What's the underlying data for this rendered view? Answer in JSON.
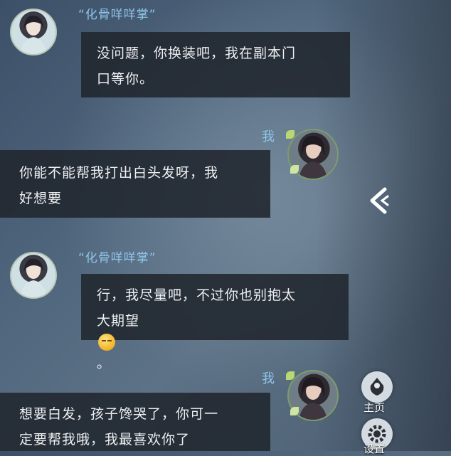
{
  "messages": [
    {
      "sender": "“化骨咩咩掌”",
      "lines": [
        "没问题，你换装吧，我在副本门",
        "口等你。"
      ]
    },
    {
      "sender": "我",
      "lines": [
        "你能不能帮我打出白头发呀，我",
        "好想要"
      ]
    },
    {
      "sender": "“化骨咩咩掌”",
      "lines": [
        "行，我尽量吧，不过你也别抱太",
        "大期望",
        "。"
      ]
    },
    {
      "sender": "我",
      "lines": [
        "想要白发，孩子馋哭了，你可一",
        "定要帮我哦，我最喜欢你了"
      ]
    }
  ],
  "side_menu": {
    "home_label": "主页",
    "settings_label": "设置"
  },
  "icons": {
    "collapse": "chevron-left-icon",
    "home": "home-icon",
    "settings": "gear-icon",
    "emoji": "sleepy-emoji-icon"
  },
  "colors": {
    "name_color": "#8fc6ea",
    "bubble_bg": "#20262e",
    "text": "#eef0f2"
  }
}
